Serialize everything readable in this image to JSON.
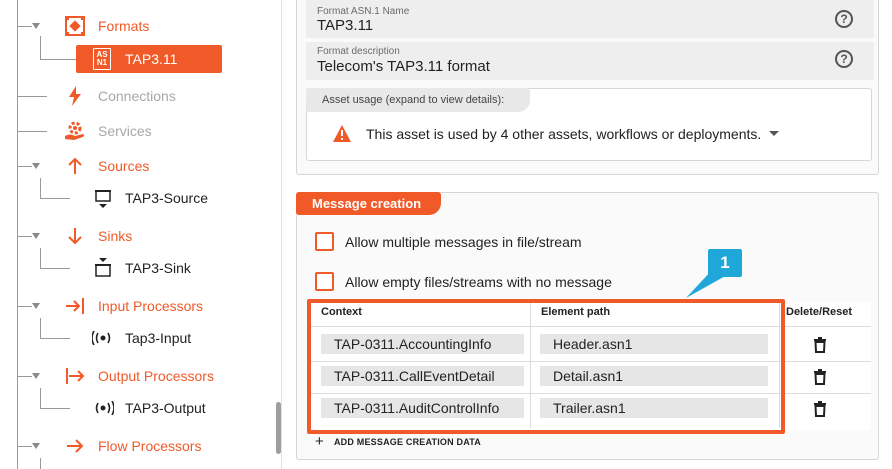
{
  "sidebar": {
    "formats": {
      "label": "Formats",
      "selected": "TAP3.11",
      "badge_top": "AS",
      "badge_bottom": "N1"
    },
    "items": [
      {
        "label": "Connections"
      },
      {
        "label": "Services"
      },
      {
        "label": "Sources",
        "child": "TAP3-Source"
      },
      {
        "label": "Sinks",
        "child": "TAP3-Sink"
      },
      {
        "label": "Input Processors",
        "child": "Tap3-Input"
      },
      {
        "label": "Output Processors",
        "child": "TAP3-Output"
      },
      {
        "label": "Flow Processors"
      }
    ]
  },
  "format": {
    "name_label": "Format ASN.1 Name",
    "name_value": "TAP3.11",
    "desc_label": "Format description",
    "desc_value": "Telecom's TAP3.11 format",
    "help_glyph": "?"
  },
  "asset_usage": {
    "tab": "Asset usage (expand to view details):",
    "text": "This asset is used by 4 other assets, workflows or deployments."
  },
  "message_creation": {
    "tab": "Message creation",
    "allow_multiple": "Allow multiple messages in file/stream",
    "allow_empty": "Allow empty files/streams with no message",
    "columns": {
      "context": "Context",
      "element_path": "Element path",
      "delete_reset": "Delete/Reset"
    },
    "rows": [
      {
        "context": "TAP-0311.AccountingInfo",
        "path": "Header.asn1"
      },
      {
        "context": "TAP-0311.CallEventDetail",
        "path": "Detail.asn1"
      },
      {
        "context": "TAP-0311.AuditControlInfo",
        "path": "Trailer.asn1"
      }
    ],
    "add_plus": "+",
    "add_label": "ADD MESSAGE CREATION DATA"
  },
  "annotation": {
    "number": "1"
  },
  "colors": {
    "accent": "#f05a28",
    "callout": "#20a7d9"
  },
  "icons": [
    "formats-icon",
    "asn1-icon",
    "lightning-icon",
    "services-icon",
    "arrow-up-icon",
    "arrow-down-icon",
    "input-processor-icon",
    "output-processor-icon",
    "flow-processor-icon",
    "source-icon",
    "sink-icon",
    "signal-icon",
    "help-icon",
    "warning-icon",
    "trash-icon",
    "caret-down-icon"
  ]
}
